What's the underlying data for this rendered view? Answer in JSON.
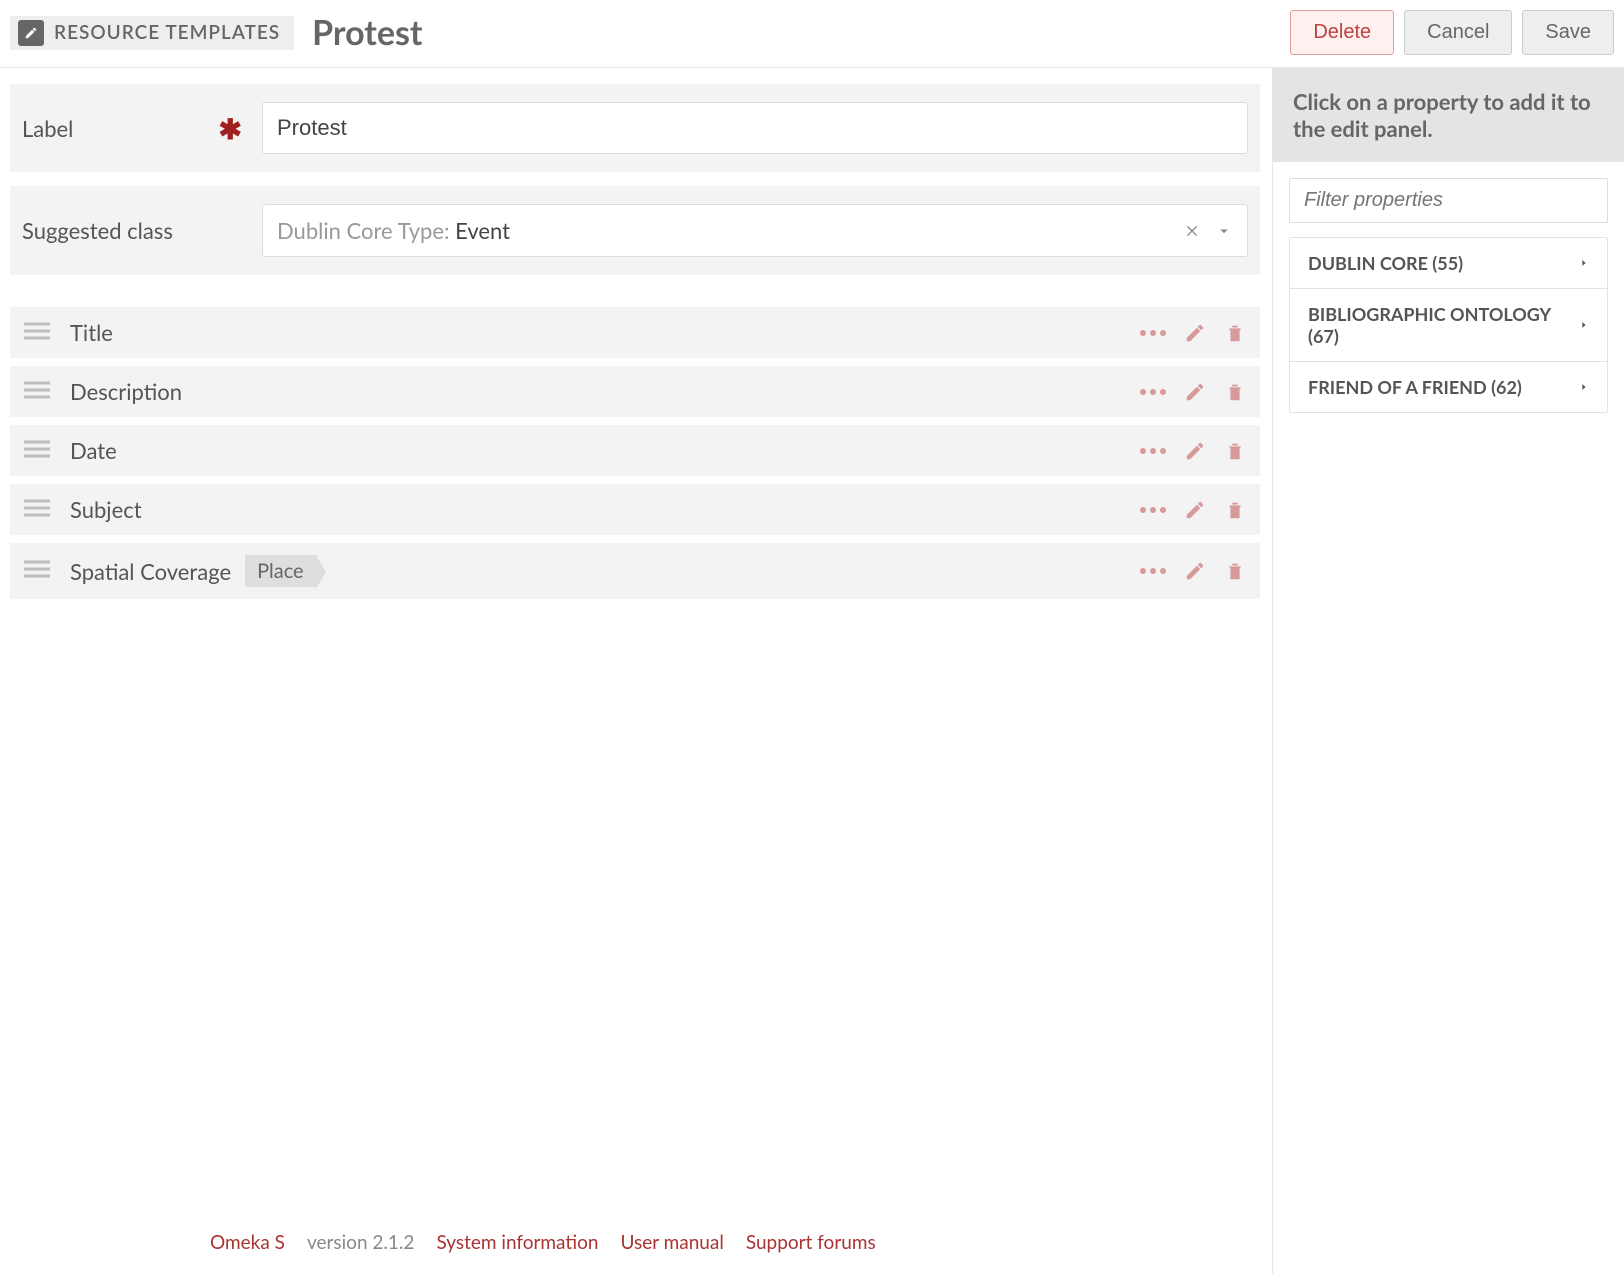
{
  "header": {
    "breadcrumb_label": "RESOURCE TEMPLATES",
    "title": "Protest",
    "delete": "Delete",
    "cancel": "Cancel",
    "save": "Save"
  },
  "form": {
    "label_field": "Label",
    "label_value": "Protest",
    "suggested_class_field": "Suggested class",
    "suggested_class_prefix": "Dublin Core Type",
    "suggested_class_value": "Event"
  },
  "properties": [
    {
      "name": "Title",
      "badge": null
    },
    {
      "name": "Description",
      "badge": null
    },
    {
      "name": "Date",
      "badge": null
    },
    {
      "name": "Subject",
      "badge": null
    },
    {
      "name": "Spatial Coverage",
      "badge": "Place"
    }
  ],
  "sidebar": {
    "instruction": "Click on a property to add it to the edit panel.",
    "filter_placeholder": "Filter properties",
    "vocabs": [
      {
        "label": "DUBLIN CORE (55)"
      },
      {
        "label": "BIBLIOGRAPHIC ONTOLOGY (67)"
      },
      {
        "label": "FRIEND OF A FRIEND (62)"
      }
    ]
  },
  "footer": {
    "app": "Omeka S",
    "version": "version 2.1.2",
    "links": [
      "System information",
      "User manual",
      "Support forums"
    ]
  }
}
